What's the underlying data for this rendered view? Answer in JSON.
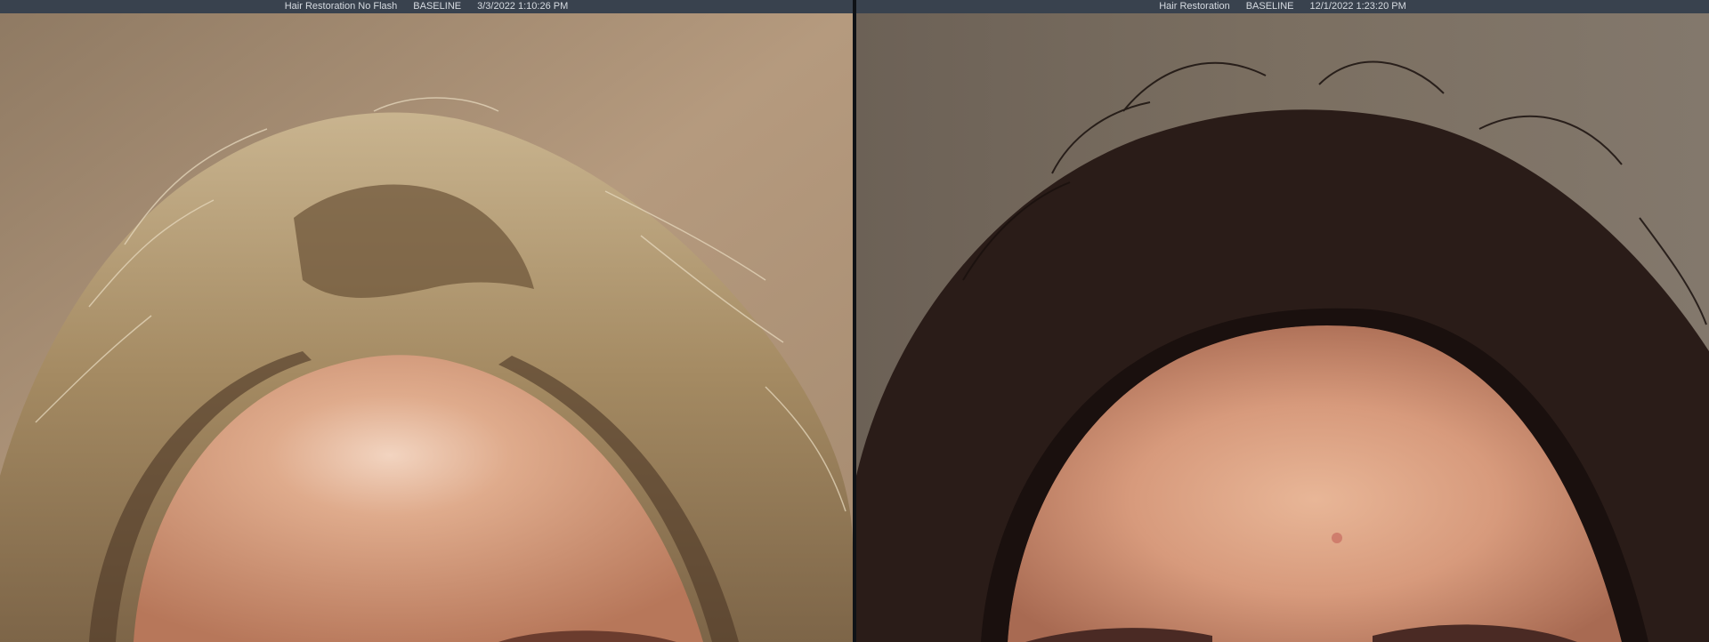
{
  "panes": [
    {
      "procedure": "Hair Restoration No Flash",
      "tag": "BASELINE",
      "datetime": "3/3/2022 1:10:26 PM"
    },
    {
      "procedure": "Hair Restoration",
      "tag": "BASELINE",
      "datetime": "12/1/2022 1:23:20 PM"
    }
  ],
  "colors": {
    "titlebar_bg": "#39424e",
    "titlebar_text": "#d6dbe1",
    "left_background": "#b59a7e",
    "left_hair": "#b79d74",
    "left_skin": "#d9a382",
    "right_background": "#7b6f61",
    "right_hair": "#2a1c18",
    "right_skin": "#d79a7c"
  }
}
